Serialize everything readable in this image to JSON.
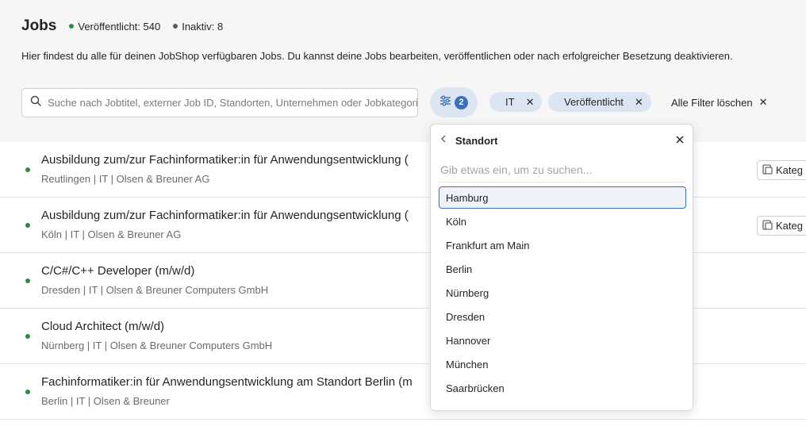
{
  "header": {
    "title": "Jobs",
    "published_label": "Veröffentlicht: 540",
    "inactive_label": "Inaktiv: 8",
    "description": "Hier findest du alle für deinen JobShop verfügbaren Jobs. Du kannst deine Jobs bearbeiten, veröffentlichen oder nach erfolgreicher Besetzung deaktivieren.",
    "colors": {
      "published_dot": "#2e8b3e",
      "inactive_dot": "#5c5c5c"
    }
  },
  "search": {
    "placeholder": "Suche nach Jobtitel, externer Job ID, Standorten, Unternehmen oder Jobkategorien",
    "value": ""
  },
  "filters": {
    "badge_count": "2",
    "chips": [
      {
        "label": "IT"
      },
      {
        "label": "Veröffentlicht"
      }
    ],
    "clear_all_label": "Alle Filter löschen",
    "accent_color": "#3b6fb6"
  },
  "jobs": [
    {
      "title": "Ausbildung zum/zur Fachinformatiker:in für Anwendungsentwicklung (",
      "meta": "Reutlingen | IT | Olsen & Breuner AG",
      "category_button": "Kateg"
    },
    {
      "title": "Ausbildung zum/zur Fachinformatiker:in für Anwendungsentwicklung (",
      "meta": "Köln | IT | Olsen & Breuner AG",
      "category_button": "Kateg"
    },
    {
      "title": "C/C#/C++ Developer (m/w/d)",
      "meta": "Dresden | IT | Olsen & Breuner Computers GmbH"
    },
    {
      "title": "Cloud Architect (m/w/d)",
      "meta": "Nürnberg | IT | Olsen & Breuner Computers GmbH"
    },
    {
      "title": "Fachinformatiker:in für Anwendungsentwicklung am Standort Berlin (m",
      "meta": "Berlin | IT | Olsen & Breuner"
    }
  ],
  "dropdown": {
    "title": "Standort",
    "search_placeholder": "Gib etwas ein, um zu suchen...",
    "options": [
      {
        "label": "Hamburg",
        "active": true
      },
      {
        "label": "Köln"
      },
      {
        "label": "Frankfurt am Main"
      },
      {
        "label": "Berlin"
      },
      {
        "label": "Nürnberg"
      },
      {
        "label": "Dresden"
      },
      {
        "label": "Hannover"
      },
      {
        "label": "München"
      },
      {
        "label": "Saarbrücken"
      }
    ]
  }
}
